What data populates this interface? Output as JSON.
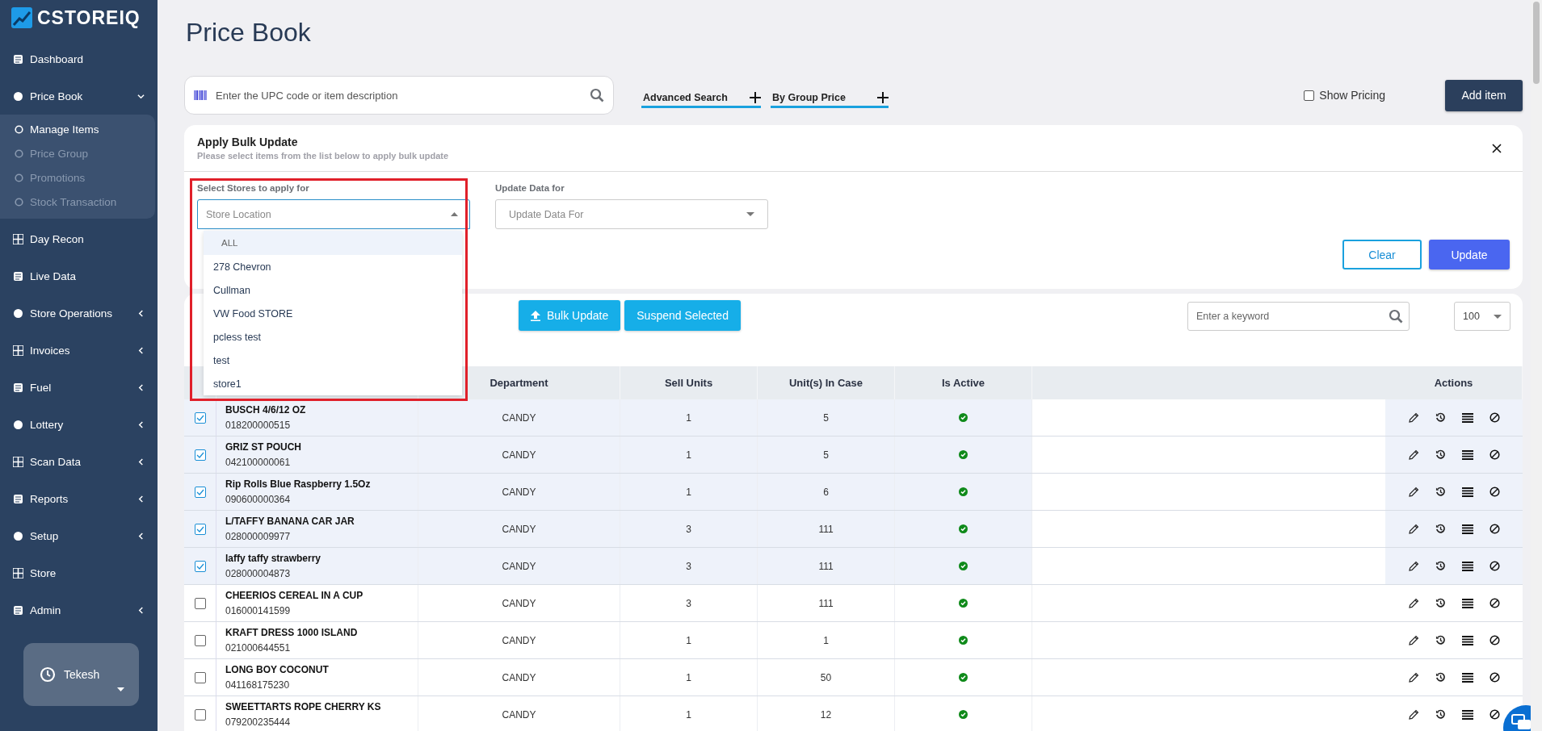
{
  "sidebar": {
    "logo": "CSTOREIQ",
    "items": [
      {
        "label": "Dashboard"
      },
      {
        "label": "Price Book",
        "expanded": true,
        "children": [
          {
            "label": "Manage Items",
            "selected": true
          },
          {
            "label": "Price Group",
            "selected": false
          },
          {
            "label": "Promotions",
            "selected": false
          },
          {
            "label": "Stock Transaction",
            "selected": false
          }
        ]
      },
      {
        "label": "Day Recon"
      },
      {
        "label": "Live Data"
      },
      {
        "label": "Store Operations",
        "expanded": false
      },
      {
        "label": "Invoices",
        "expanded": false
      },
      {
        "label": "Fuel",
        "expanded": false
      },
      {
        "label": "Lottery",
        "expanded": false
      },
      {
        "label": "Scan Data",
        "expanded": false
      },
      {
        "label": "Reports",
        "expanded": false
      },
      {
        "label": "Setup",
        "expanded": false
      },
      {
        "label": "Store"
      },
      {
        "label": "Admin",
        "expanded": false
      }
    ],
    "user": {
      "name": "Tekesh"
    }
  },
  "page": {
    "title": "Price Book"
  },
  "search": {
    "placeholder": "Enter the UPC code or item description"
  },
  "filters": [
    {
      "label": "Advanced Search"
    },
    {
      "label": "By Group Price"
    }
  ],
  "show_pricing": {
    "label": "Show Pricing",
    "checked": false
  },
  "add_button": "Add item",
  "bulk_update": {
    "title": "Apply Bulk Update",
    "subtitle": "Please select items from the list below to apply bulk update",
    "stores": {
      "label": "Select Stores to apply for",
      "placeholder": "Store Location",
      "expanded": true,
      "options": [
        {
          "label": "ALL",
          "selected": true
        },
        {
          "label": "278 Chevron",
          "selected": false
        },
        {
          "label": "Cullman",
          "selected": false
        },
        {
          "label": "VW Food STORE",
          "selected": false
        },
        {
          "label": "pcless test",
          "selected": false
        },
        {
          "label": "test",
          "selected": false
        },
        {
          "label": "store1",
          "selected": false
        }
      ]
    },
    "update_for": {
      "label": "Update Data for",
      "placeholder": "Update Data For"
    },
    "buttons": [
      {
        "label": "Clear",
        "kind": "outline"
      },
      {
        "label": "Update",
        "kind": "primary"
      }
    ]
  },
  "toolbar": {
    "buttons": [
      {
        "label": "Bulk Update",
        "kind": "upload"
      },
      {
        "label": "Suspend Selected",
        "kind": "plain"
      }
    ],
    "keyword_placeholder": "Enter a keyword",
    "page_size": "100"
  },
  "table": {
    "columns": {
      "department": "Department",
      "sell_units": "Sell Units",
      "units_in_case": "Unit(s) In Case",
      "active": "Is Active",
      "actions": "Actions"
    },
    "rows": [
      {
        "checked": true,
        "name": "BUSCH 4/6/12 OZ",
        "upc": "018200000515",
        "department": "CANDY",
        "sell_units": "1",
        "units_in_case": "5",
        "active": true
      },
      {
        "checked": true,
        "name": "GRIZ ST POUCH",
        "upc": "042100000061",
        "department": "CANDY",
        "sell_units": "1",
        "units_in_case": "5",
        "active": true
      },
      {
        "checked": true,
        "name": "Rip Rolls Blue Raspberry 1.5Oz",
        "upc": "090600000364",
        "department": "CANDY",
        "sell_units": "1",
        "units_in_case": "6",
        "active": true
      },
      {
        "checked": true,
        "name": "L/TAFFY BANANA CAR JAR",
        "upc": "028000009977",
        "department": "CANDY",
        "sell_units": "3",
        "units_in_case": "111",
        "active": true
      },
      {
        "checked": true,
        "name": "laffy taffy strawberry",
        "upc": "028000004873",
        "department": "CANDY",
        "sell_units": "3",
        "units_in_case": "111",
        "active": true
      },
      {
        "checked": false,
        "name": "CHEERIOS CEREAL IN A CUP",
        "upc": "016000141599",
        "department": "CANDY",
        "sell_units": "3",
        "units_in_case": "111",
        "active": true
      },
      {
        "checked": false,
        "name": "KRAFT DRESS 1000 ISLAND",
        "upc": "021000644551",
        "department": "CANDY",
        "sell_units": "1",
        "units_in_case": "1",
        "active": true
      },
      {
        "checked": false,
        "name": "LONG BOY COCONUT",
        "upc": "041168175230",
        "department": "CANDY",
        "sell_units": "1",
        "units_in_case": "50",
        "active": true
      },
      {
        "checked": false,
        "name": "SWEETTARTS ROPE CHERRY KS",
        "upc": "079200235444",
        "department": "CANDY",
        "sell_units": "1",
        "units_in_case": "12",
        "active": true
      }
    ]
  }
}
